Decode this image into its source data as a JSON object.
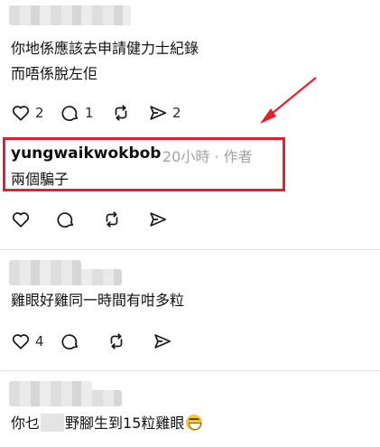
{
  "comments": [
    {
      "text_lines": [
        "你地係應該去申請健力士紀錄",
        "而唔係脫左佢"
      ],
      "counts": {
        "likes": "2",
        "replies": "1",
        "shares": "2"
      }
    },
    {
      "author": "yungwaikwokbob",
      "time": "20小時",
      "separator": "·",
      "author_tag": "作者",
      "text": "兩個騙子",
      "highlight_color": "#e5202a"
    },
    {
      "text": "雞眼好雞同一時間有咁多粒",
      "counts": {
        "likes": "4"
      }
    },
    {
      "text_before": "你乜",
      "text_after": "野腳生到15粒雞眼",
      "emoji": "grinning-squinting-face"
    }
  ],
  "icons": [
    "heart-icon",
    "comment-icon",
    "repost-icon",
    "share-icon"
  ]
}
